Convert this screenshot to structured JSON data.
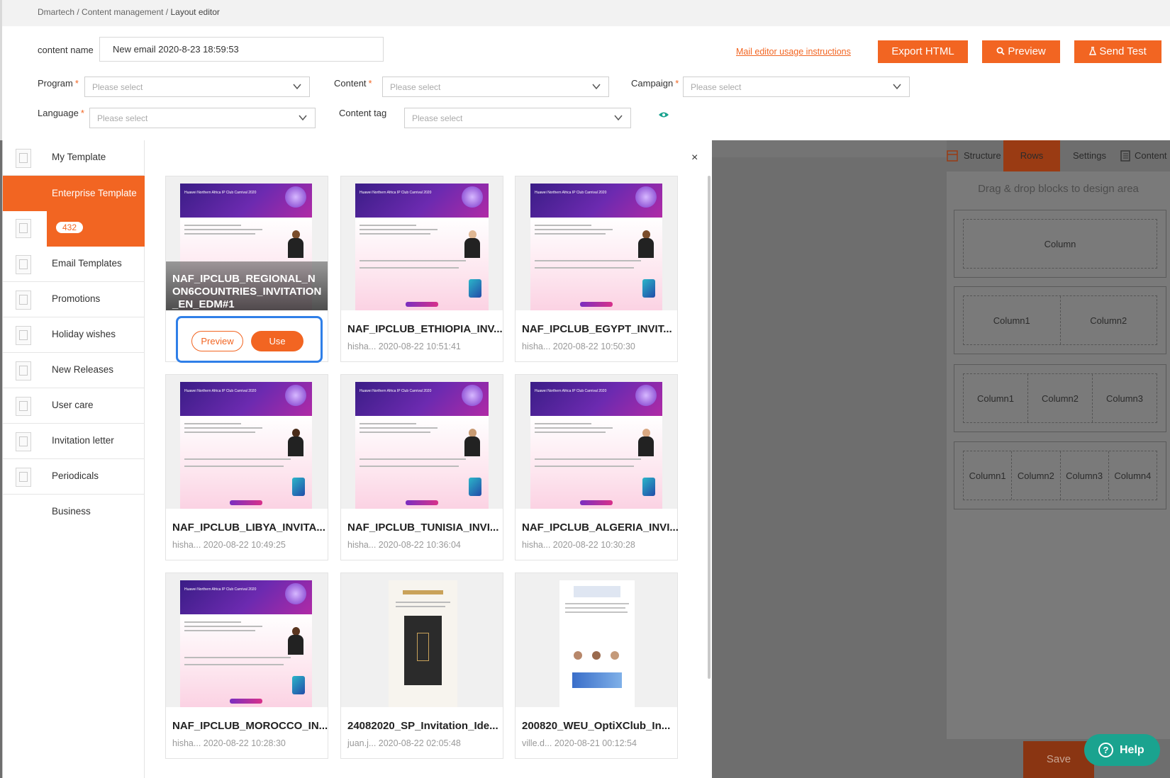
{
  "breadcrumb": {
    "part1": "Dmartech",
    "sep": "/",
    "part2": "Content management",
    "current": "Layout editor"
  },
  "form": {
    "content_name_label": "content name",
    "content_name_value": "New email 2020-8-23 18:59:53",
    "usage_link": "Mail editor usage instructions",
    "export_label": "Export HTML",
    "preview_label": "Preview",
    "send_test_label": "Send Test",
    "program_label": "Program",
    "content_label": "Content",
    "campaign_label": "Campaign",
    "language_label": "Language",
    "content_tag_label": "Content tag",
    "placeholder": "Please select",
    "required_mark": "*"
  },
  "right_panel": {
    "tabs": [
      "Structure",
      "Rows",
      "Settings",
      "Content"
    ],
    "hint": "Drag & drop blocks to design area",
    "rows": [
      [
        "Column"
      ],
      [
        "Column1",
        "Column2"
      ],
      [
        "Column1",
        "Column2",
        "Column3"
      ],
      [
        "Column1",
        "Column2",
        "Column3",
        "Column4"
      ]
    ],
    "save_label": "Save",
    "help_label": "Help"
  },
  "modal": {
    "close": "×",
    "sidebar": [
      {
        "label": "My Template",
        "icon": "star-doc-icon"
      },
      {
        "label": "Enterprise Template",
        "icon": "image-doc-icon",
        "count": "432"
      },
      {
        "label": "Email Templates",
        "icon": "grid-doc-icon"
      },
      {
        "label": "Promotions",
        "icon": "code-doc-icon"
      },
      {
        "label": "Holiday wishes",
        "icon": "doc-icon"
      },
      {
        "label": "New Releases",
        "icon": "star-doc-icon"
      },
      {
        "label": "User care",
        "icon": "image-doc-icon"
      },
      {
        "label": "Invitation letter",
        "icon": "grid-doc-icon"
      },
      {
        "label": "Periodicals",
        "icon": "code-doc-icon"
      },
      {
        "label": "Business",
        "icon": ""
      }
    ],
    "thumb_header": "Huawei Northern Africa IP Club Carnival 2020",
    "cards": [
      {
        "name": "NAF_IPCLUB_REGIONAL_NON6COUNTRIES_INVITATION_EN_EDM#1",
        "meta": "",
        "hover": true,
        "preview": "Preview",
        "use": "Use"
      },
      {
        "name": "NAF_IPCLUB_ETHIOPIA_INV...",
        "meta": "hisha... 2020-08-22 10:51:41"
      },
      {
        "name": "NAF_IPCLUB_EGYPT_INVIT...",
        "meta": "hisha... 2020-08-22 10:50:30"
      },
      {
        "name": "NAF_IPCLUB_LIBYA_INVITA...",
        "meta": "hisha... 2020-08-22 10:49:25"
      },
      {
        "name": "NAF_IPCLUB_TUNISIA_INVI...",
        "meta": "hisha... 2020-08-22 10:36:04"
      },
      {
        "name": "NAF_IPCLUB_ALGERIA_INVI...",
        "meta": "hisha... 2020-08-22 10:30:28"
      },
      {
        "name": "NAF_IPCLUB_MOROCCO_IN...",
        "meta": "hisha... 2020-08-22 10:28:30"
      },
      {
        "name": "24082020_SP_Invitation_Ide...",
        "meta": "juan.j... 2020-08-22 02:05:48"
      },
      {
        "name": "200820_WEU_OptiXClub_In...",
        "meta": "ville.d... 2020-08-21 00:12:54"
      }
    ]
  },
  "colors": {
    "accent": "#f26522",
    "focus": "#2f7fe8",
    "help": "#1aa38f"
  }
}
